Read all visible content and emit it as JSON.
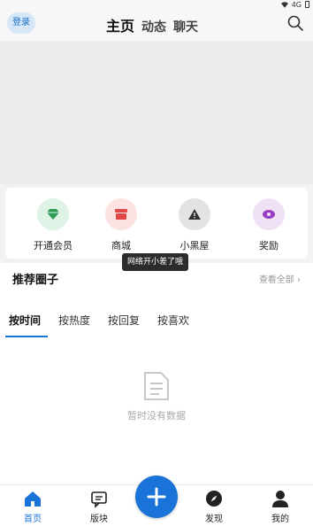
{
  "status_bar": {
    "signal_text": "4G"
  },
  "header": {
    "login_label": "登录",
    "tabs": [
      "主页",
      "动态",
      "聊天"
    ]
  },
  "quick_actions": [
    {
      "label": "开通会员",
      "icon": "gem-icon",
      "bg": "#dff2e6",
      "fg": "#2e9c55"
    },
    {
      "label": "商城",
      "icon": "shop-icon",
      "bg": "#fde2e2",
      "fg": "#e04848"
    },
    {
      "label": "小黑屋",
      "icon": "warning-icon",
      "bg": "#e3e3e5",
      "fg": "#333333"
    },
    {
      "label": "奖励",
      "icon": "reward-icon",
      "bg": "#efe2f7",
      "fg": "#9b3fc4"
    }
  ],
  "toast": "网络开小差了哦",
  "circles": {
    "title": "推荐圈子",
    "see_all": "查看全部",
    "sort_tabs": [
      "按时间",
      "按热度",
      "按回复",
      "按喜欢"
    ],
    "empty_text": "暂时没有数据"
  },
  "bottom_nav": {
    "items": [
      "首页",
      "版块",
      "发现",
      "我的"
    ],
    "accent": "#1a73d8"
  }
}
